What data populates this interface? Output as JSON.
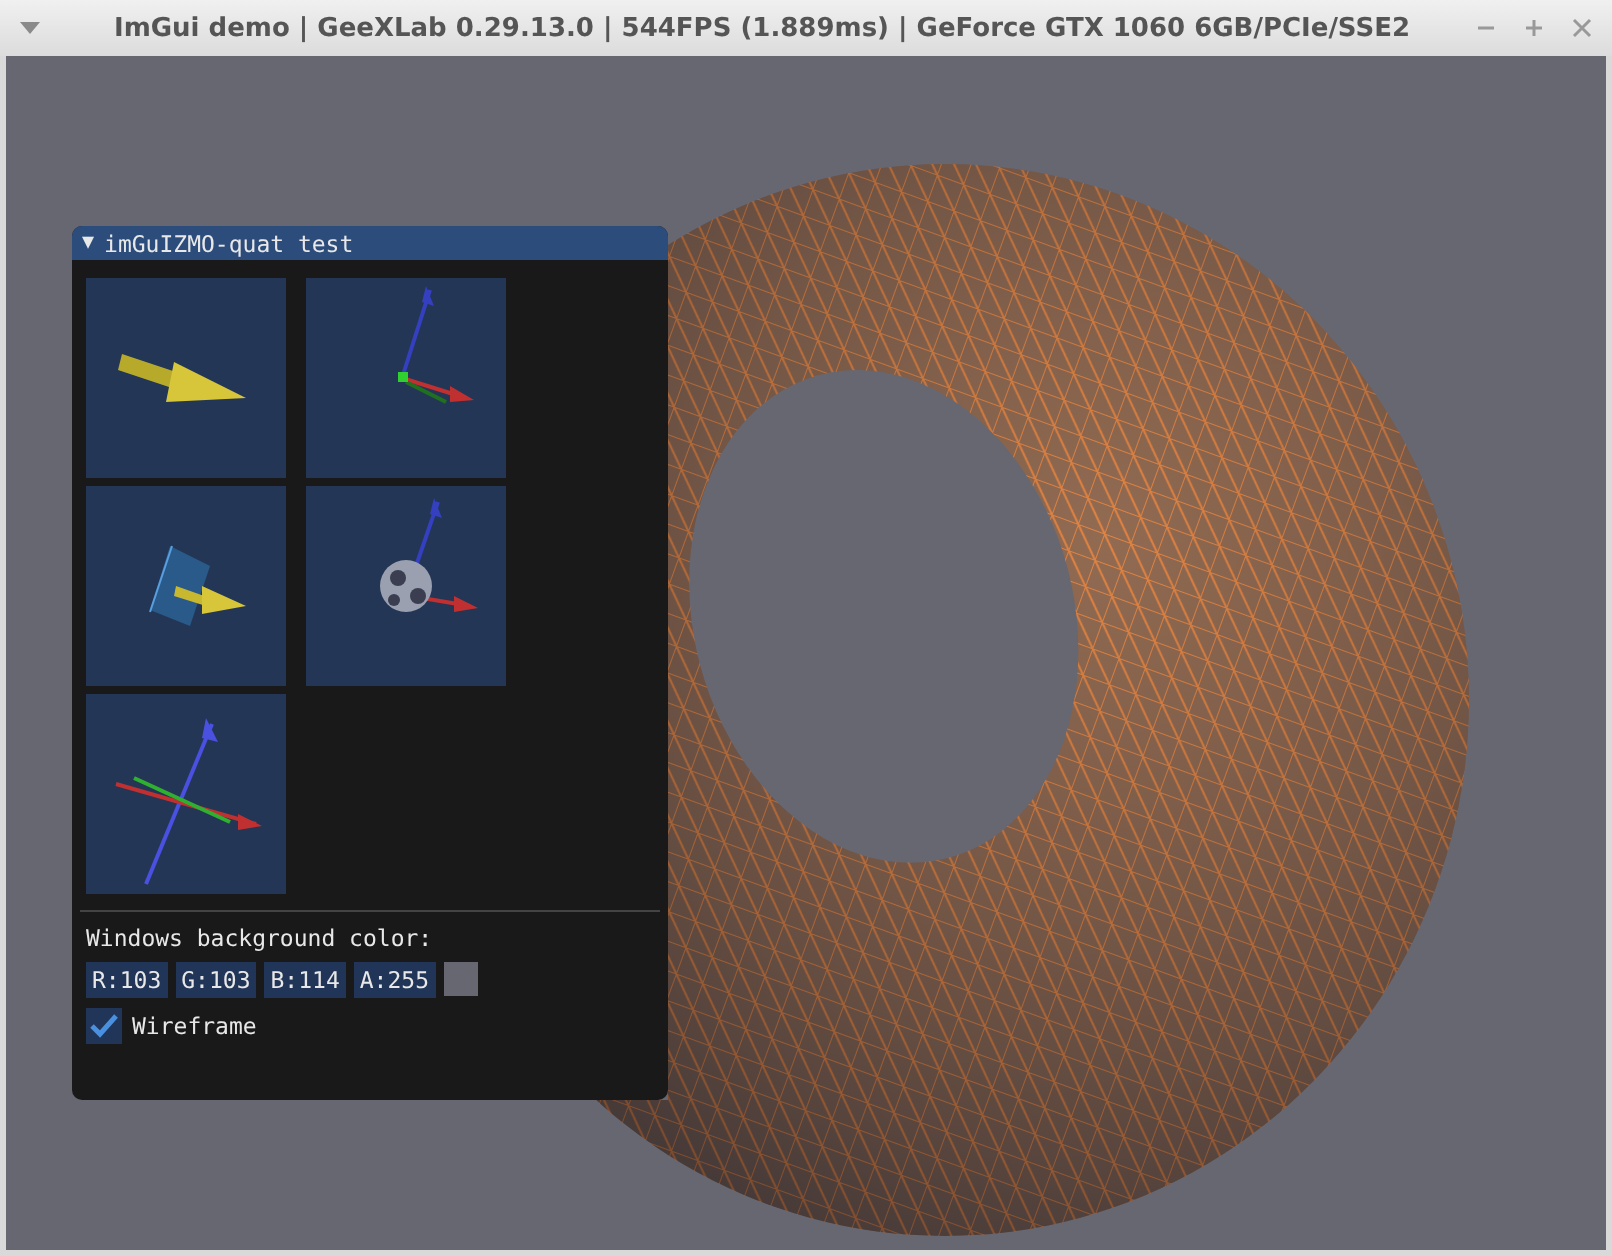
{
  "window": {
    "title": "ImGui demo | GeeXLab 0.29.13.0 | 544FPS (1.889ms) | GeForce GTX 1060 6GB/PCIe/SSE2"
  },
  "panel": {
    "collapse_glyph": "▼",
    "title": "imGuIZMO-quat test",
    "expanded": true,
    "gizmos": [
      {
        "kind": "arrow"
      },
      {
        "kind": "axes"
      },
      {
        "kind": "plane-arrow"
      },
      {
        "kind": "sphere-axes"
      },
      {
        "kind": "axes-wide"
      }
    ],
    "color_label": "Windows background color:",
    "color_fields": [
      {
        "value": "R:103"
      },
      {
        "value": "G:103"
      },
      {
        "value": "B:114"
      },
      {
        "value": "A:255"
      }
    ],
    "swatch": {
      "color": "#676772"
    },
    "wireframe": {
      "label": "Wireframe",
      "checked": true
    }
  }
}
